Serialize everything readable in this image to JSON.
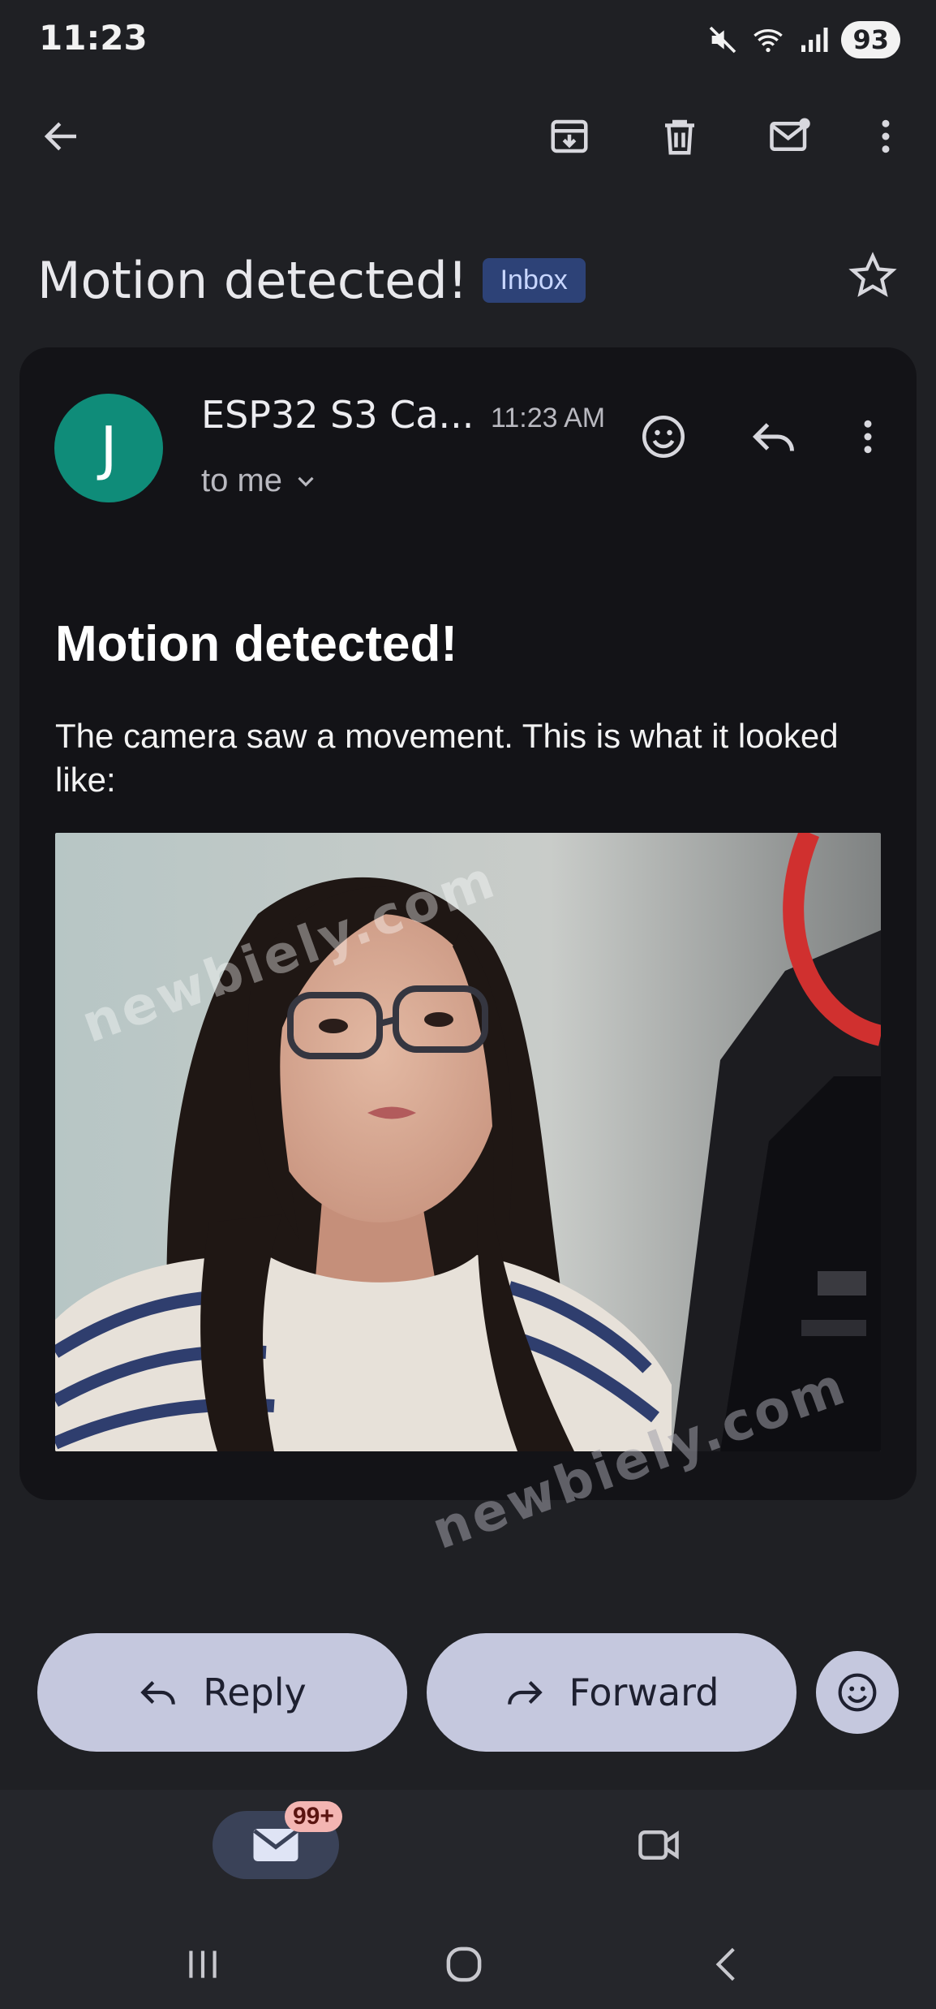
{
  "status_bar": {
    "time": "11:23",
    "battery": "93",
    "icons": [
      "mute-icon",
      "wifi-icon",
      "signal-icon"
    ]
  },
  "toolbar": {
    "icons": [
      "back-arrow-icon",
      "archive-icon",
      "trash-icon",
      "mark-unread-icon",
      "more-vert-icon"
    ]
  },
  "email": {
    "subject": "Motion detected!",
    "label": "Inbox",
    "sender_initial": "J",
    "sender_name": "ESP32 S3 Ca...",
    "time": "11:23 AM",
    "recipient": "to me",
    "body_title": "Motion detected!",
    "body_text": "The camera saw a movement. This is what it looked like:",
    "image_watermark": "newbiely.com"
  },
  "page_watermark": "newbiely.com",
  "actions": {
    "reply_label": "Reply",
    "forward_label": "Forward"
  },
  "bottom_nav": {
    "mail_badge": "99+"
  },
  "colors": {
    "background": "#1f2024",
    "card": "#131317",
    "avatar": "#0f8c79",
    "label_chip": "#2d4277",
    "pill": "#c5c8de",
    "badge": "#f3b5b2"
  }
}
